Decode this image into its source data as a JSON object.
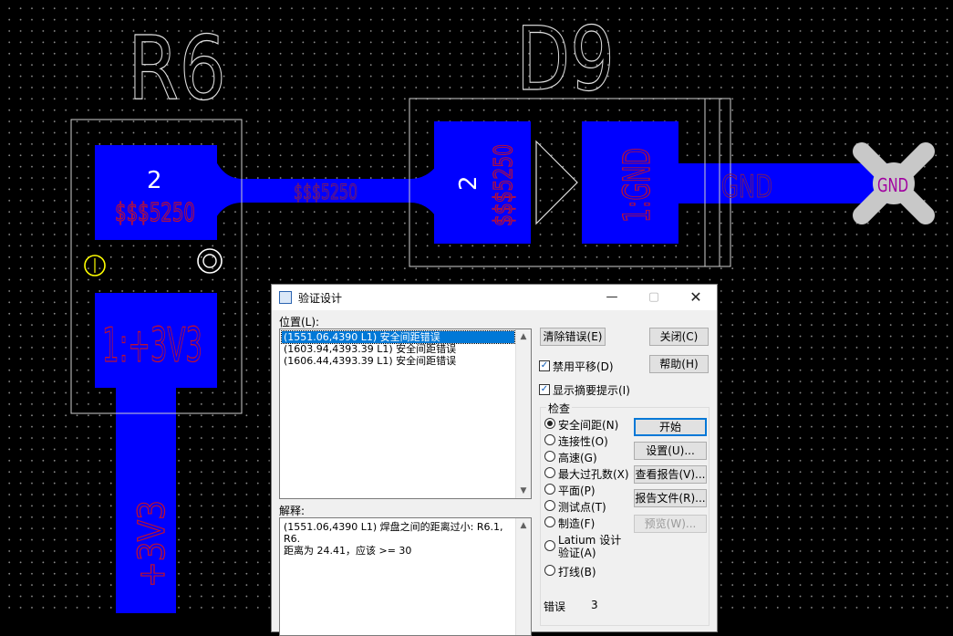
{
  "pcb": {
    "r6_designator": "R6",
    "d9_designator": "D9",
    "r6_pad2_number": "2",
    "r6_pad2_net": "$$$5250",
    "r6_pad1_label": "1:+3V3",
    "trace_net_label": "$$$5250",
    "d9_pad2_number": "2",
    "d9_pad2_net": "$$$5250",
    "d9_pad1_label": "1:GND",
    "gnd_trace_label": "GND",
    "gnd_marker_label": "GND",
    "vertical_trace_label": "+3V3",
    "colors": {
      "copper": "#0000ff",
      "silk": "#ffffff",
      "netname": "#c0102e",
      "marker": "#ffff00",
      "gnd_label": "#a000a0"
    }
  },
  "dialog": {
    "title": "验证设计",
    "minimize_icon": "minimize-icon",
    "maximize_icon": "maximize-icon",
    "close_icon": "close-icon",
    "location_label": "位置(L):",
    "errors": [
      "(1551.06,4390 L1) 安全间距错误",
      "(1603.94,4393.39 L1) 安全间距错误",
      "(1606.44,4393.39 L1) 安全间距错误"
    ],
    "explanation_label": "解释:",
    "explanation_text": "(1551.06,4390 L1) 焊盘之间的距离过小: R6.1, R6.\n距离为 24.41，应该 >= 30",
    "buttons": {
      "clear_errors": "清除错误(E)",
      "close": "关闭(C)",
      "help": "帮助(H)",
      "start": "开始",
      "settings": "设置(U)...",
      "view_report": "查看报告(V)...",
      "report_file": "报告文件(R)...",
      "preview": "预览(W)..."
    },
    "checkboxes": {
      "disable_pan": {
        "label": "禁用平移(D)",
        "checked": true
      },
      "show_summary": {
        "label": "显示摘要提示(I)",
        "checked": true
      }
    },
    "check_group_label": "检查",
    "radios": [
      {
        "label": "安全间距(N)",
        "selected": true
      },
      {
        "label": "连接性(O)",
        "selected": false
      },
      {
        "label": "高速(G)",
        "selected": false
      },
      {
        "label": "最大过孔数(X)",
        "selected": false
      },
      {
        "label": "平面(P)",
        "selected": false
      },
      {
        "label": "测试点(T)",
        "selected": false
      },
      {
        "label": "制造(F)",
        "selected": false
      },
      {
        "label": "Latium 设计验证(A)",
        "selected": false
      },
      {
        "label": "打线(B)",
        "selected": false
      }
    ],
    "error_count_label": "错误",
    "error_count_value": "3"
  }
}
